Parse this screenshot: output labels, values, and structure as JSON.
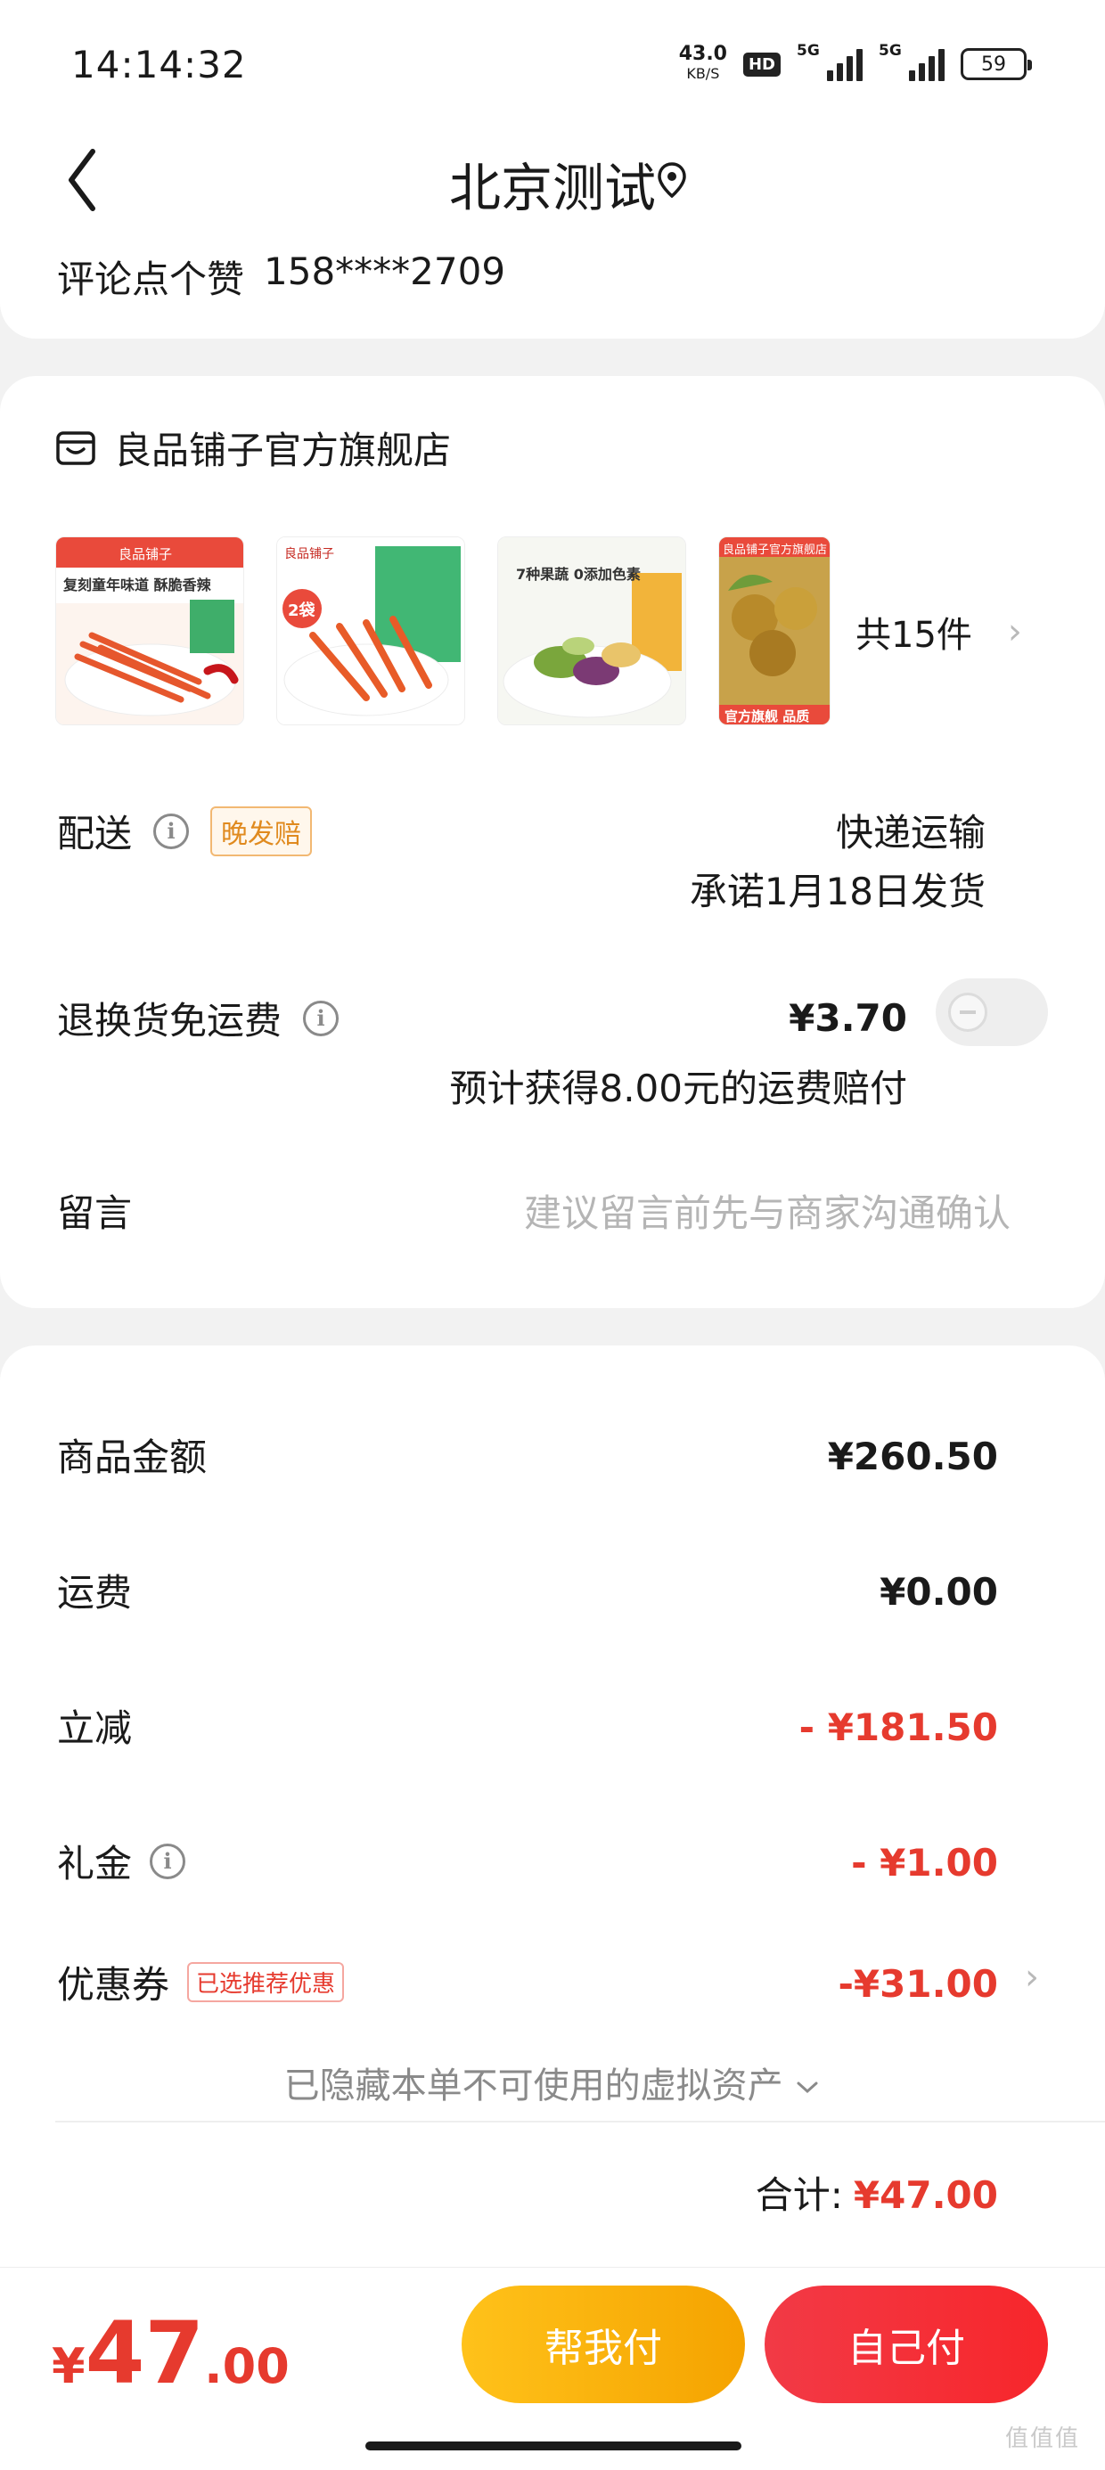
{
  "status_bar": {
    "time": "14:14:32",
    "net_speed_value": "43.0",
    "net_speed_unit": "KB/S",
    "hd_label": "HD",
    "signal_1_tag": "5G",
    "signal_2_tag": "5G",
    "battery": "59"
  },
  "header": {
    "title": "北京测试",
    "address_label": "评论点个赞",
    "phone": "158****2709"
  },
  "shop": {
    "name": "良品铺子官方旗舰店",
    "products": [
      {
        "caption": "复刻童年味道 酥脆香辣",
        "brand": "良品铺子"
      },
      {
        "caption": "2袋",
        "brand": "良品铺子"
      },
      {
        "caption": "7种果蔬 0添加色素",
        "brand": ""
      },
      {
        "caption": "官方旗舰 品质",
        "brand": "良品铺子官方旗舰店"
      }
    ],
    "item_count": "共15件"
  },
  "delivery": {
    "label": "配送",
    "tag": "晚发赔",
    "method": "快递运输",
    "promise": "承诺1月18日发货"
  },
  "return_freight": {
    "label": "退换货免运费",
    "price": "¥3.70",
    "note": "预计获得8.00元的运费赔付"
  },
  "message": {
    "label": "留言",
    "placeholder": "建议留言前先与商家沟通确认"
  },
  "summary": {
    "goods_label": "商品金额",
    "goods_value": "¥260.50",
    "shipping_label": "运费",
    "shipping_value": "¥0.00",
    "discount_label": "立减",
    "discount_value": "- ¥181.50",
    "gift_label": "礼金",
    "gift_value": "- ¥1.00",
    "coupon_label": "优惠券",
    "coupon_tag": "已选推荐优惠",
    "coupon_value": "-¥31.00",
    "hidden_assets": "已隐藏本单不可使用的虚拟资产",
    "total_label": "合计:",
    "total_value": "¥47.00"
  },
  "bottom_bar": {
    "currency": "¥",
    "amount_int": "47",
    "amount_dec": ".00",
    "help_pay_label": "帮我付",
    "self_pay_label": "自己付"
  },
  "watermark": "值值值",
  "colors": {
    "accent_red": "#e63a2e",
    "accent_orange": "#f5a300",
    "tag_orange": "#e08a1e"
  }
}
